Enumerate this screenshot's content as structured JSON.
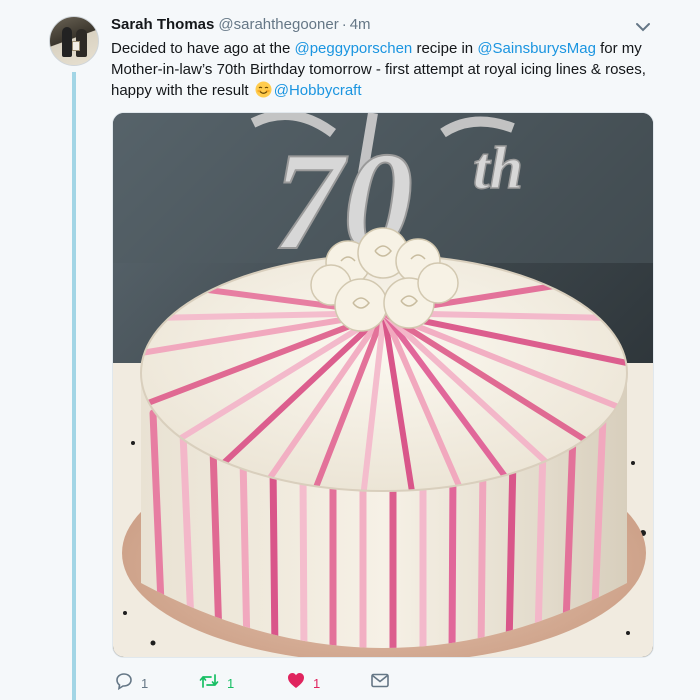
{
  "tweet": {
    "author": {
      "display_name": "Sarah Thomas",
      "handle": "@sarahthegooner",
      "separator": "·",
      "time": "4m"
    },
    "text": {
      "part1": "Decided to have ago at the ",
      "mention1": "@peggyporschen",
      "part2": " recipe in ",
      "mention2": "@SainsburysMag",
      "part3": " for my Mother-in-law’s 70th Birthday tomorrow - first attempt at royal icing lines & roses, happy with the result ",
      "mention3": "@Hobbycraft",
      "emoji": "smiling-face-with-blush-emoji"
    },
    "media": {
      "topper_text": "70",
      "topper_suffix": "th",
      "description_icon": "cake-photo"
    },
    "actions": {
      "reply_count": "1",
      "retweet_count": "1",
      "like_count": "1",
      "liked": true,
      "retweeted": true
    }
  },
  "colors": {
    "link": "#1b95e0",
    "retweet": "#17bf63",
    "like": "#e0245e",
    "thread_line": "#a2d5e5",
    "muted": "#657786"
  }
}
